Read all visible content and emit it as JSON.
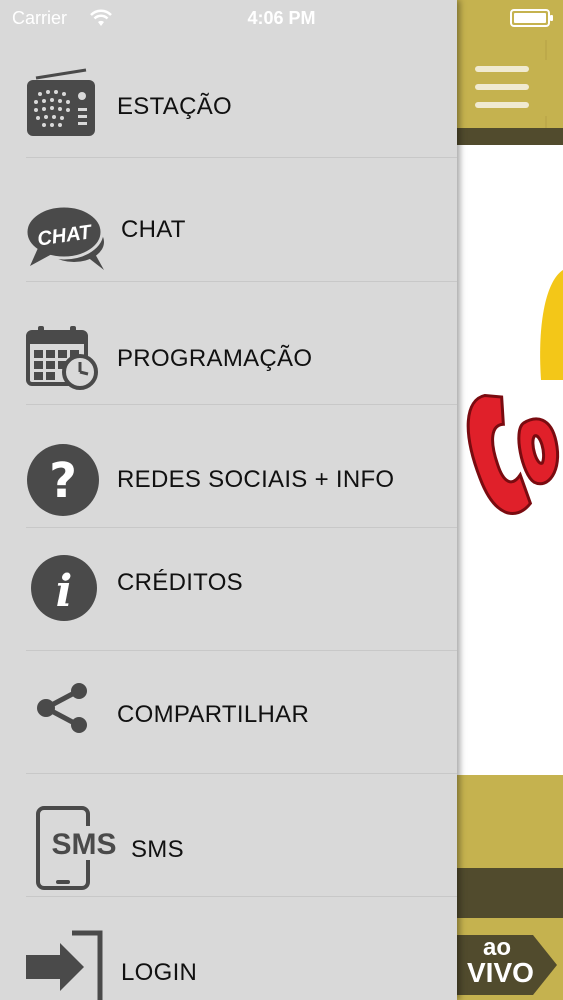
{
  "status_bar": {
    "carrier": "Carrier",
    "time": "4:06 PM"
  },
  "drawer": {
    "items": [
      {
        "label": "ESTAÇÃO",
        "icon": "radio-icon"
      },
      {
        "label": "CHAT",
        "icon": "chat-bubble-icon"
      },
      {
        "label": "PROGRAMAÇÃO",
        "icon": "calendar-clock-icon"
      },
      {
        "label": "REDES SOCIAIS + INFO",
        "icon": "question-icon"
      },
      {
        "label": "CRÉDITOS",
        "icon": "info-icon"
      },
      {
        "label": "COMPARTILHAR",
        "icon": "share-icon"
      },
      {
        "label": "SMS",
        "icon": "sms-phone-icon"
      },
      {
        "label": "LOGIN",
        "icon": "login-arrow-icon"
      }
    ]
  },
  "icons": {
    "chat_text": "CHAT",
    "sms_text": "SMS"
  },
  "app": {
    "live_button": {
      "line1": "ao",
      "line2": "VIVO"
    }
  },
  "colors": {
    "drawer_bg": "#d9d9d9",
    "gold": "#c5b24f",
    "dark_band": "#514b2d",
    "icon_gray": "#4a4a4a",
    "logo_red": "#e0202a",
    "logo_yellow": "#f3c718"
  }
}
